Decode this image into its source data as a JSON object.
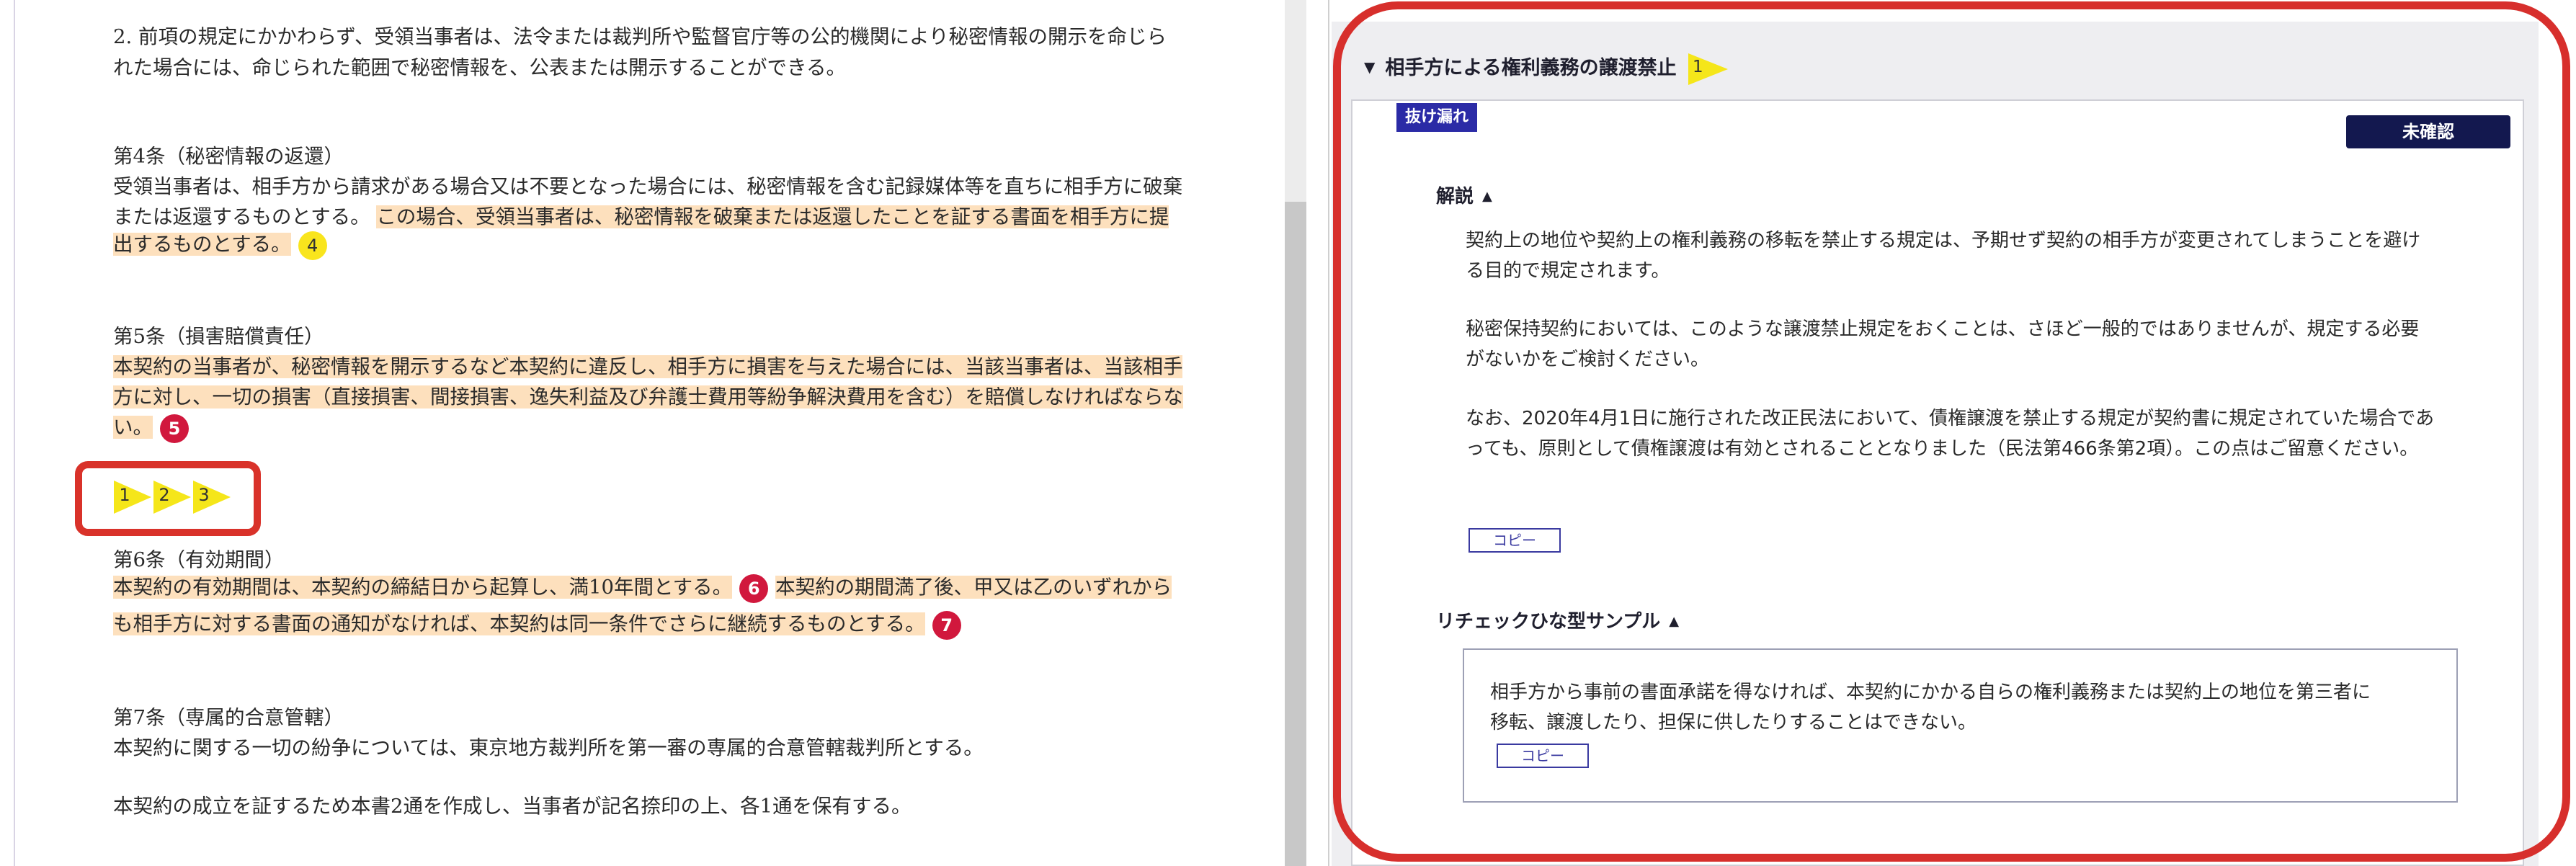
{
  "document": {
    "art3_p2_line1": "2.  前項の規定にかかわらず、受領当事者は、法令または裁判所や監督官庁等の公的機関により秘密情報の開示を命じら",
    "art3_p2_line2": "れた場合には、命じられた範囲で秘密情報を、公表または開示することができる。",
    "art4_title": "第4条（秘密情報の返還）",
    "art4_line1": "受領当事者は、相手方から請求がある場合又は不要となった場合には、秘密情報を含む記録媒体等を直ちに相手方に破棄",
    "art4_line2a": "または返還するものとする。",
    "art4_line2b": "この場合、受領当事者は、秘密情報を破棄または返還したことを証する書面を相手方に提",
    "art4_line3": "出するものとする。",
    "art4_marker": "4",
    "art5_title": "第5条（損害賠償責任）",
    "art5_line1": "本契約の当事者が、秘密情報を開示するなど本契約に違反し、相手方に損害を与えた場合には、当該当事者は、当該相手",
    "art5_line2": "方に対し、一切の損害（直接損害、間接損害、逸失利益及び弁護士費用等紛争解決費用を含む）を賠償しなければならな",
    "art5_line3": "い。",
    "art5_marker": "5",
    "inserted_markers": [
      "1",
      "2",
      "3"
    ],
    "art6_title": "第6条（有効期間）",
    "art6_line1a": "本契約の有効期間は、本契約の締結日から起算し、満10年間とする。",
    "art6_marker_a": "6",
    "art6_line1b": "本契約の期間満了後、甲又は乙のいずれから",
    "art6_line2": "も相手方に対する書面の通知がなければ、本契約は同一条件でさらに継続するものとする。",
    "art6_marker_b": "7",
    "art7_title": "第7条（専属的合意管轄）",
    "art7_line1": "本契約に関する一切の紛争については、東京地方裁判所を第一審の専属的合意管轄裁判所とする。",
    "closing_line": "本契約の成立を証するため本書2通を作成し、当事者が記名捺印の上、各1通を保有する。"
  },
  "panel": {
    "header_title": "相手方による権利義務の譲渡禁止",
    "header_marker": "1",
    "missing_badge": "抜け漏れ",
    "status_button": "未確認",
    "explanation_title": "解説",
    "explanation_lines": [
      "契約上の地位や契約上の権利義務の移転を禁止する規定は、予期せず契約の相手方が変更されてしまうことを避け",
      "る目的で規定されます。",
      "秘密保持契約においては、このような譲渡禁止規定をおくことは、さほど一般的ではありませんが、規定する必要",
      "がないかをご検討ください。",
      "なお、2020年4月1日に施行された改正民法において、債権譲渡を禁止する規定が契約書に規定されていた場合であ",
      "っても、原則として債権譲渡は有効とされることとなりました（民法第466条第2項）。この点はご留意ください。"
    ],
    "copy_label": "コピー",
    "sample_title": "リチェックひな型サンプル",
    "sample_lines": [
      "相手方から事前の書面承諾を得なければ、本契約にかかる自らの権利義務または契約上の地位を第三者に",
      "移転、譲渡したり、担保に供したりすることはできない。"
    ],
    "sample_copy_label": "コピー"
  },
  "colors": {
    "highlight": "#fde0bd",
    "marker_yellow": "#f9e51d",
    "marker_red": "#d1183d",
    "annotation_red": "#d72f2c",
    "badge_blue": "#2b2ba6",
    "status_navy": "#13184f"
  },
  "icons": {
    "collapse": "triangle-down-icon",
    "section_toggle": "caret-up-icon",
    "marker": "arrow-flag-icon"
  }
}
